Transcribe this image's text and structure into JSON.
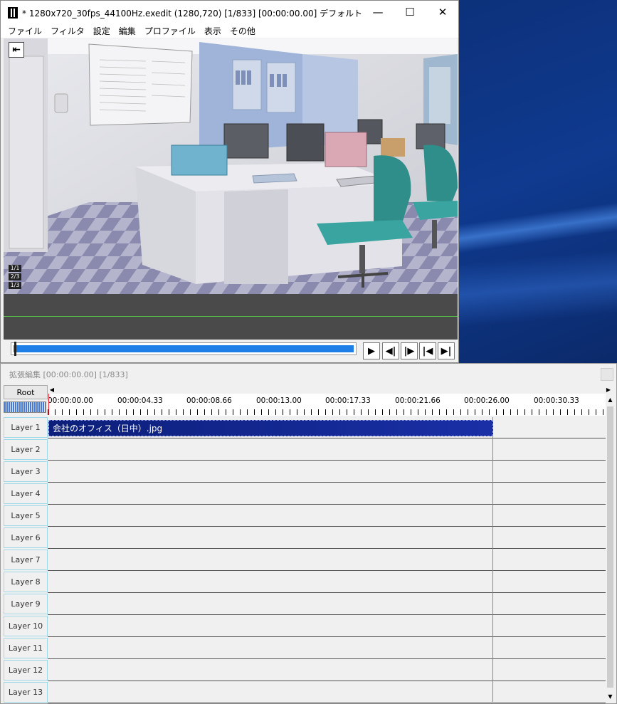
{
  "main_window": {
    "title": "* 1280x720_30fps_44100Hz.exedit (1280,720)  [1/833] [00:00:00.00]  デフォルト",
    "controls": {
      "minimize": "—",
      "maximize": "☐",
      "close": "✕"
    },
    "menu": [
      "ファイル",
      "フィルタ",
      "設定",
      "編集",
      "プロファイル",
      "表示",
      "その他"
    ],
    "viewer": {
      "frame_button": "⇤",
      "badges": [
        "1/1",
        "2/3",
        "1/3"
      ]
    },
    "playback": {
      "progress": 1.0,
      "buttons": [
        "▶",
        "◀|",
        "|▶",
        "|◀",
        "▶|"
      ]
    }
  },
  "extended_edit": {
    "title": "拡張編集 [00:00:00.00] [1/833]",
    "root_label": "Root",
    "ruler_ticks": [
      "00:00:00.00",
      "00:00:04.33",
      "00:00:08.66",
      "00:00:13.00",
      "00:00:17.33",
      "00:00:21.66",
      "00:00:26.00",
      "00:00:30.33"
    ],
    "layers": [
      "Layer 1",
      "Layer 2",
      "Layer 3",
      "Layer 4",
      "Layer 5",
      "Layer 6",
      "Layer 7",
      "Layer 8",
      "Layer 9",
      "Layer 10",
      "Layer 11",
      "Layer 12",
      "Layer 13"
    ],
    "clip": {
      "label": "会社のオフィス（日中）.jpg",
      "layer": 1,
      "start": "00:00:00.00",
      "end": "00:00:26.00"
    },
    "colors": {
      "clip": "#1a2fa6",
      "cursor": "#ee2233",
      "layer_border": "#9fd8e6"
    }
  }
}
